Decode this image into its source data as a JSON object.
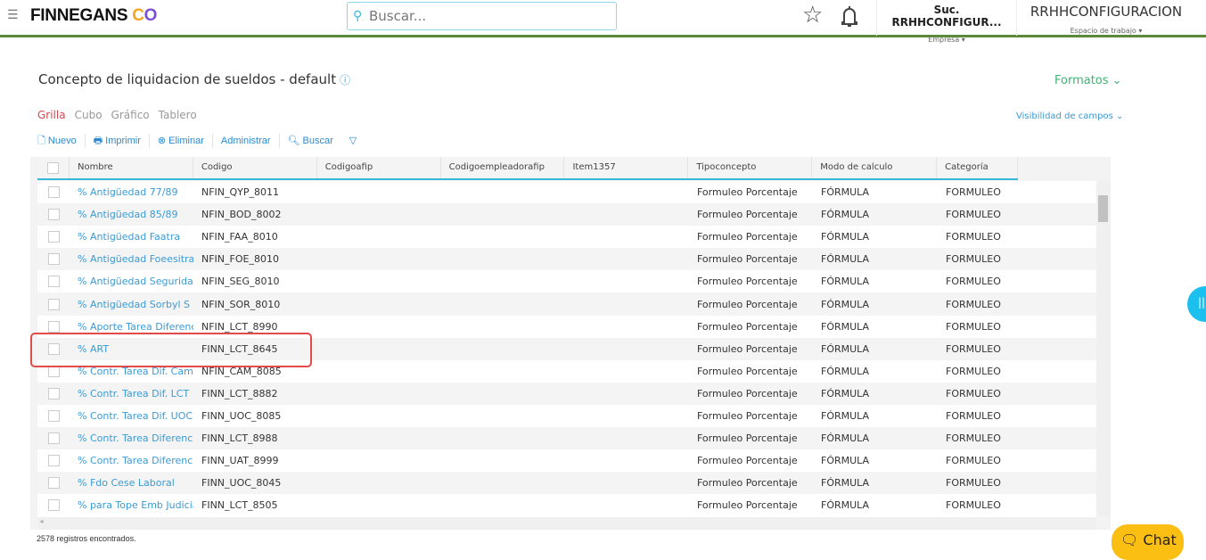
{
  "header": {
    "logo": "FINNEGANS",
    "search_placeholder": "Buscar...",
    "empresa_value": "Suc. RRHHCONFIGUR...",
    "empresa_label": "Empresa ▾",
    "workspace_value": "RRHHCONFIGURACION",
    "workspace_label": "Espacio de trabajo ▾"
  },
  "page": {
    "title": "Concepto de liquidacion de sueldos - default",
    "formatos": "Formatos ⌄",
    "visibilidad": "Visibilidad de campos ⌄"
  },
  "tabs": [
    "Grilla",
    "Cubo",
    "Gráfico",
    "Tablero"
  ],
  "toolbar": {
    "nuevo": "Nuevo",
    "imprimir": "Imprimir",
    "eliminar": "Eliminar",
    "administrar": "Administrar",
    "buscar": "Buscar"
  },
  "columns": [
    "Nombre",
    "Codigo",
    "Codigoafip",
    "Codigoempleadorafip",
    "Item1357",
    "Tipoconcepto",
    "Modo de calculo",
    "Categoría"
  ],
  "rows": [
    [
      "% Antigüedad 77/89",
      "NFIN_QYP_8011",
      "",
      "",
      "",
      "Formuleo Porcentaje",
      "FÓRMULA",
      "FORMULEO"
    ],
    [
      "% Antigüedad 85/89",
      "NFIN_BOD_8002",
      "",
      "",
      "",
      "Formuleo Porcentaje",
      "FÓRMULA",
      "FORMULEO"
    ],
    [
      "% Antigüedad Faatra",
      "NFIN_FAA_8010",
      "",
      "",
      "",
      "Formuleo Porcentaje",
      "FÓRMULA",
      "FORMULEO"
    ],
    [
      "% Antigüedad Foeesitra",
      "NFIN_FOE_8010",
      "",
      "",
      "",
      "Formuleo Porcentaje",
      "FÓRMULA",
      "FORMULEO"
    ],
    [
      "% Antigüedad Seguridad",
      "NFIN_SEG_8010",
      "",
      "",
      "",
      "Formuleo Porcentaje",
      "FÓRMULA",
      "FORMULEO"
    ],
    [
      "% Antigüedad Sorbyl S",
      "NFIN_SOR_8010",
      "",
      "",
      "",
      "Formuleo Porcentaje",
      "FÓRMULA",
      "FORMULEO"
    ],
    [
      "% Aporte Tarea Diferencial",
      "NFIN_LCT_8990",
      "",
      "",
      "",
      "Formuleo Porcentaje",
      "FÓRMULA",
      "FORMULEO"
    ],
    [
      "% ART",
      "FINN_LCT_8645",
      "",
      "",
      "",
      "Formuleo Porcentaje",
      "FÓRMULA",
      "FORMULEO"
    ],
    [
      "% Contr. Tarea Dif. Camioneros",
      "NFIN_CAM_8085",
      "",
      "",
      "",
      "Formuleo Porcentaje",
      "FÓRMULA",
      "FORMULEO"
    ],
    [
      "% Contr. Tarea Dif. LCT",
      "FINN_LCT_8882",
      "",
      "",
      "",
      "Formuleo Porcentaje",
      "FÓRMULA",
      "FORMULEO"
    ],
    [
      "% Contr. Tarea Dif. UOCRA",
      "FINN_UOC_8085",
      "",
      "",
      "",
      "Formuleo Porcentaje",
      "FÓRMULA",
      "FORMULEO"
    ],
    [
      "% Contr. Tarea Diferencial",
      "FINN_LCT_8988",
      "",
      "",
      "",
      "Formuleo Porcentaje",
      "FÓRMULA",
      "FORMULEO"
    ],
    [
      "% Contr. Tarea Diferencial",
      "FINN_UAT_8999",
      "",
      "",
      "",
      "Formuleo Porcentaje",
      "FÓRMULA",
      "FORMULEO"
    ],
    [
      "% Fdo Cese Laboral",
      "FINN_UOC_8045",
      "",
      "",
      "",
      "Formuleo Porcentaje",
      "FÓRMULA",
      "FORMULEO"
    ],
    [
      "% para Tope Emb Judicial",
      "FINN_LCT_8505",
      "",
      "",
      "",
      "Formuleo Porcentaje",
      "FÓRMULA",
      "FORMULEO"
    ]
  ],
  "footer": "2578 registros encontrados.",
  "chat": "Chat"
}
